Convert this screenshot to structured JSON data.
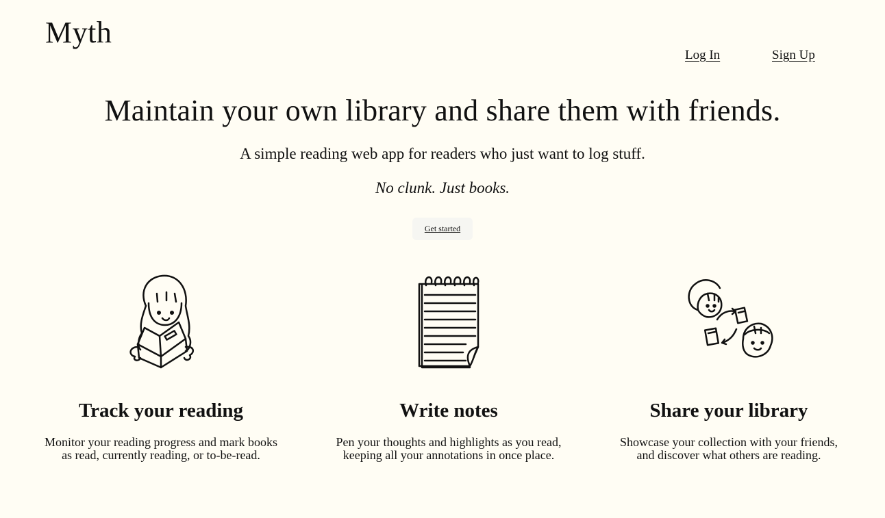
{
  "brand": {
    "name": "Myth"
  },
  "nav": {
    "login": "Log In",
    "signup": "Sign Up"
  },
  "hero": {
    "title": "Maintain your own library and share them with friends.",
    "subtitle": "A simple reading web app for readers who just want to log stuff.",
    "tagline": "No clunk. Just books.",
    "cta": "Get started"
  },
  "features": [
    {
      "icon": "reading-girl-illustration",
      "title": "Track your reading",
      "description": "Monitor your reading progress and mark books as read, currently reading, or to-be-read."
    },
    {
      "icon": "notepad-illustration",
      "title": "Write notes",
      "description": "Pen your thoughts and highlights as you read, keeping all your annotations in once place."
    },
    {
      "icon": "friends-sharing-books-illustration",
      "title": "Share your library",
      "description": "Showcase your collection with your friends, and discover what others are reading."
    }
  ],
  "colors": {
    "background": "#fffdf4",
    "text": "#111111",
    "button_bg": "#f6f6f2"
  }
}
